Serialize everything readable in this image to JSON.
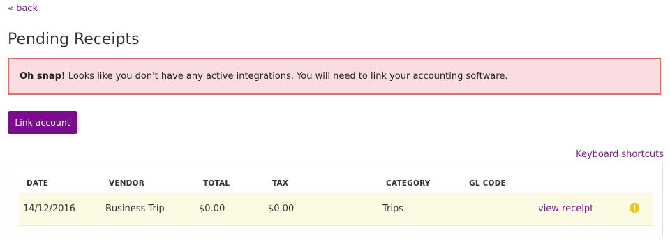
{
  "nav": {
    "back_label": "« back"
  },
  "page": {
    "title": "Pending Receipts"
  },
  "alert": {
    "strong": "Oh snap!",
    "message": "Looks like you don't have any active integrations. You will need to link your accounting software."
  },
  "actions": {
    "link_account_label": "Link account",
    "keyboard_shortcuts_label": "Keyboard shortcuts"
  },
  "table": {
    "headers": {
      "date": "DATE",
      "vendor": "VENDOR",
      "total": "TOTAL",
      "tax": "TAX",
      "category": "CATEGORY",
      "gl_code": "GL CODE"
    },
    "rows": [
      {
        "date": "14/12/2016",
        "vendor": "Business Trip",
        "total": "$0.00",
        "tax": "$0.00",
        "category": "Trips",
        "gl_code": "",
        "action_label": "view receipt",
        "status_icon": "warning-icon"
      }
    ]
  },
  "colors": {
    "brand": "#7b0c8e",
    "link": "#7a1a8c",
    "alert_bg": "#f9dde1",
    "alert_border": "#e26d6d",
    "row_highlight": "#fbfbe4",
    "warning": "#f0c419"
  }
}
